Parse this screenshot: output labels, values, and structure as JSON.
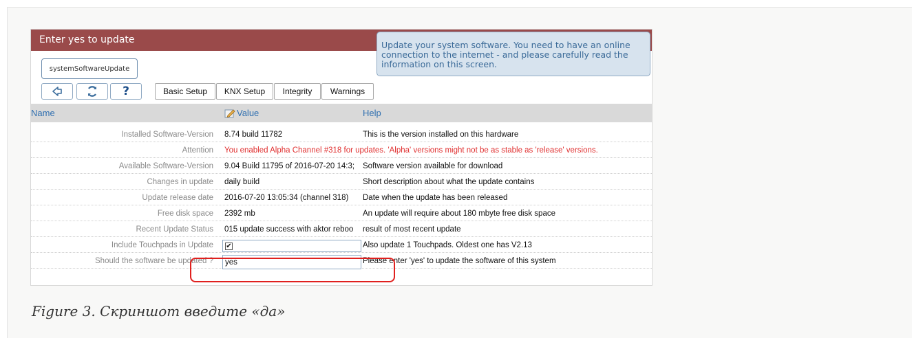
{
  "window": {
    "title": "Enter yes to update",
    "help_text": "Update your system software. You need to have an online connection to the internet - and please carefully read the information on this screen."
  },
  "command_button": {
    "label": "systemSoftwareUpdate"
  },
  "toolbar": {
    "nav_icons": [
      "back-arrow-icon",
      "refresh-icon",
      "help-question-icon"
    ],
    "help_glyph": "?",
    "tabs": [
      {
        "label": "Basic Setup"
      },
      {
        "label": "KNX Setup"
      },
      {
        "label": "Integrity"
      },
      {
        "label": "Warnings"
      }
    ]
  },
  "table": {
    "headers": {
      "name": "Name",
      "value": "Value",
      "help": "Help"
    },
    "rows": [
      {
        "label": "Installed Software-Version",
        "value": "8.74 build 11782",
        "help": "This is the version installed on this hardware"
      },
      {
        "label": "Attention",
        "alert": "You enabled Alpha Channel #318 for updates. 'Alpha' versions might not be as stable as 'release' versions."
      },
      {
        "label": "Available Software-Version",
        "value": "9.04 Build 11795 of 2016-07-20 14:3;",
        "help": "Software version available for download"
      },
      {
        "label": "Changes in update",
        "value": "daily build",
        "help": "Short description about what the update contains"
      },
      {
        "label": "Update release date",
        "value": "2016-07-20 13:05:34 (channel 318)",
        "help": "Date when the update has been released"
      },
      {
        "label": "Free disk space",
        "value": "2392 mb",
        "help": "An update will require about 180 mbyte free disk space"
      },
      {
        "label": "Recent Update Status",
        "value": "015 update success with aktor reboo",
        "help": "result of most recent update"
      },
      {
        "label": "Include Touchpads in Update",
        "checked": true,
        "check_glyph": "✔",
        "help": "Also update 1 Touchpads. Oldest one has V2.13"
      },
      {
        "label": "Should the software be updated ?",
        "input_value": "yes",
        "help": "Please enter 'yes' to update the software of this system"
      }
    ]
  },
  "colors": {
    "title_bar": "#9a4a4a",
    "header_text": "#2f6fb0",
    "alert_text": "#e03030",
    "highlight": "#e0201e"
  },
  "caption": "Figure 3. Скриншот введите «да»"
}
